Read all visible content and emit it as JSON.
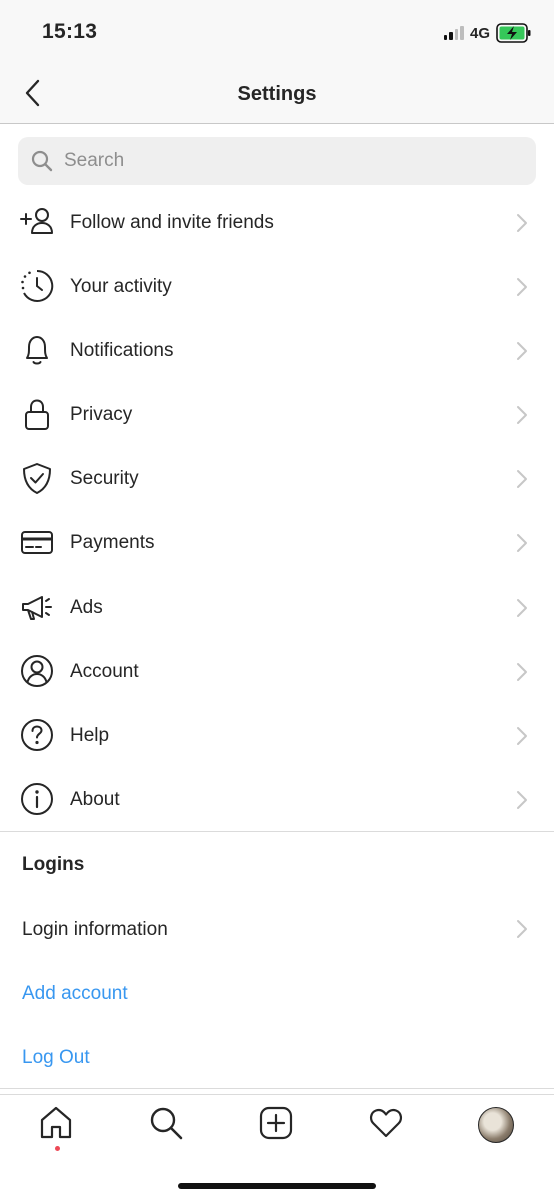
{
  "status_bar": {
    "time": "15:13",
    "network": "4G",
    "battery_color": "#35c759"
  },
  "header": {
    "title": "Settings",
    "back_icon": "chevron-left-icon"
  },
  "search": {
    "placeholder": "Search",
    "value": ""
  },
  "menu": [
    {
      "label": "Follow and invite friends",
      "icon": "add-person-icon"
    },
    {
      "label": "Your activity",
      "icon": "activity-clock-icon"
    },
    {
      "label": "Notifications",
      "icon": "bell-icon"
    },
    {
      "label": "Privacy",
      "icon": "lock-icon"
    },
    {
      "label": "Security",
      "icon": "shield-check-icon"
    },
    {
      "label": "Payments",
      "icon": "credit-card-icon"
    },
    {
      "label": "Ads",
      "icon": "megaphone-icon"
    },
    {
      "label": "Account",
      "icon": "account-circle-icon"
    },
    {
      "label": "Help",
      "icon": "help-circle-icon"
    },
    {
      "label": "About",
      "icon": "info-circle-icon"
    }
  ],
  "logins": {
    "title": "Logins",
    "login_information": "Login information",
    "add_account": "Add account",
    "log_out": "Log Out"
  },
  "tab_bar": {
    "tabs": [
      "home-icon",
      "search-icon",
      "new-post-icon",
      "heart-icon",
      "profile-avatar"
    ]
  },
  "colors": {
    "link": "#3897f0",
    "text": "#262626",
    "notification_dot": "#ed4956"
  }
}
